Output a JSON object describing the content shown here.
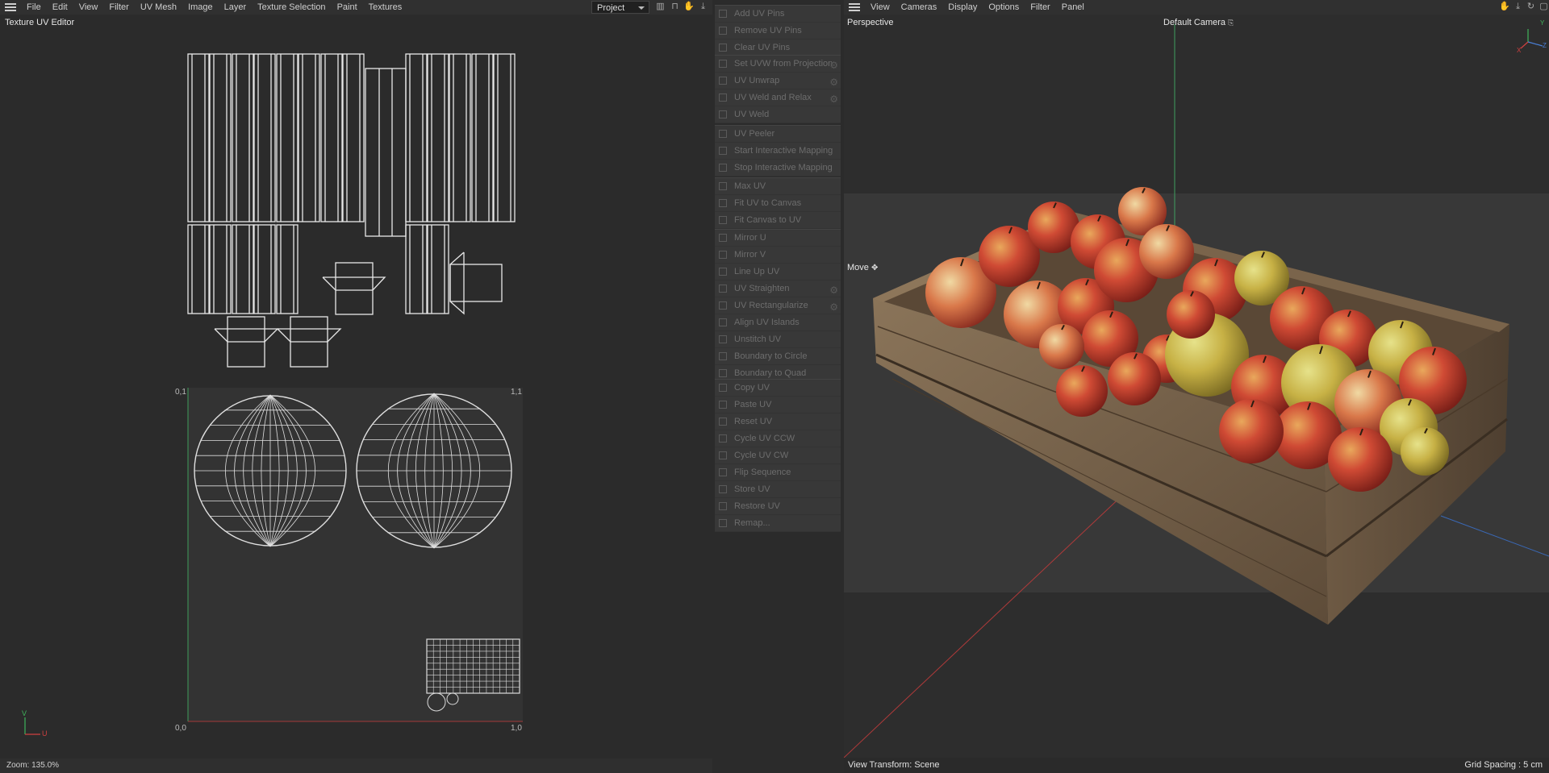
{
  "uv_editor": {
    "menu": [
      "File",
      "Edit",
      "View",
      "Filter",
      "UV Mesh",
      "Image",
      "Layer",
      "Texture Selection",
      "Paint",
      "Textures"
    ],
    "panel_title": "Texture UV Editor",
    "project_select": "Project",
    "corner_labels": {
      "top_left": "0,1",
      "top_right": "1,1",
      "bottom_left": "0,0",
      "bottom_right": "1,0"
    },
    "axis_v": "V",
    "axis_u": "U",
    "zoom": "Zoom: 135.0%"
  },
  "palette": {
    "groups": [
      {
        "items": [
          {
            "label": "Add UV Pins"
          },
          {
            "label": "Remove UV Pins"
          },
          {
            "label": "Clear UV Pins"
          }
        ]
      },
      {
        "items": [
          {
            "label": "Set UVW from Projection",
            "gear": true
          },
          {
            "label": "UV Unwrap",
            "gear": true
          },
          {
            "label": "UV Weld and Relax",
            "gear": true
          },
          {
            "label": "UV Weld"
          }
        ]
      },
      {
        "items": [
          {
            "label": "UV Peeler"
          },
          {
            "label": "Start Interactive Mapping"
          },
          {
            "label": "Stop Interactive Mapping"
          }
        ]
      },
      {
        "items": [
          {
            "label": "Max UV"
          },
          {
            "label": "Fit UV to Canvas"
          },
          {
            "label": "Fit Canvas to UV"
          }
        ]
      },
      {
        "items": [
          {
            "label": "Mirror U"
          },
          {
            "label": "Mirror V"
          },
          {
            "label": "Line Up UV"
          },
          {
            "label": "UV Straighten",
            "gear": true
          },
          {
            "label": "UV Rectangularize",
            "gear": true
          },
          {
            "label": "Align UV Islands"
          },
          {
            "label": "Unstitch UV"
          },
          {
            "label": "Boundary to Circle"
          },
          {
            "label": "Boundary to Quad"
          }
        ]
      },
      {
        "items": [
          {
            "label": "Copy UV"
          },
          {
            "label": "Paste UV"
          },
          {
            "label": "Reset UV"
          },
          {
            "label": "Cycle UV CCW"
          },
          {
            "label": "Cycle UV CW"
          },
          {
            "label": "Flip Sequence"
          },
          {
            "label": "Store UV"
          },
          {
            "label": "Restore UV"
          },
          {
            "label": "Remap..."
          }
        ]
      }
    ]
  },
  "viewport": {
    "menu": [
      "View",
      "Cameras",
      "Display",
      "Options",
      "Filter",
      "Panel"
    ],
    "mode": "Perspective",
    "camera": "Default Camera",
    "tool": "Move",
    "view_transform": "View Transform: Scene",
    "grid_spacing": "Grid Spacing : 5 cm",
    "axis_labels": {
      "x": "X",
      "y": "Y",
      "z": "Z"
    }
  }
}
